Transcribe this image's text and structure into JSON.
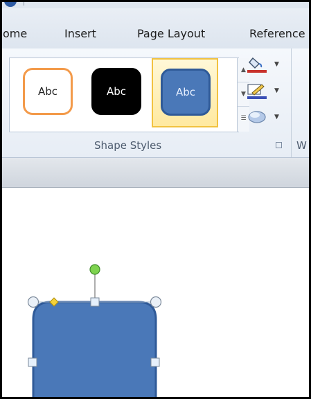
{
  "ribbon": {
    "tabs": [
      {
        "label": "ome"
      },
      {
        "label": "Insert"
      },
      {
        "label": "Page Layout"
      },
      {
        "label": "Reference"
      }
    ],
    "shape_styles": {
      "group_label": "Shape Styles",
      "styles": [
        {
          "label": "Abc",
          "fill": "#ffffff",
          "border": "#f39a4a",
          "selected": false
        },
        {
          "label": "Abc",
          "fill": "#000000",
          "border": "#000000",
          "selected": false
        },
        {
          "label": "Abc",
          "fill": "#4a78b8",
          "border": "#2f5a98",
          "selected": true
        }
      ],
      "tools": [
        {
          "name": "shape-fill",
          "icon": "paint-bucket-icon"
        },
        {
          "name": "shape-outline",
          "icon": "pencil-outline-icon"
        },
        {
          "name": "shape-effects",
          "icon": "shape-effects-icon"
        }
      ]
    },
    "next_group_label": "W"
  },
  "document": {
    "shape": {
      "fill": "#4a78b8",
      "border": "#2f5a98"
    }
  }
}
